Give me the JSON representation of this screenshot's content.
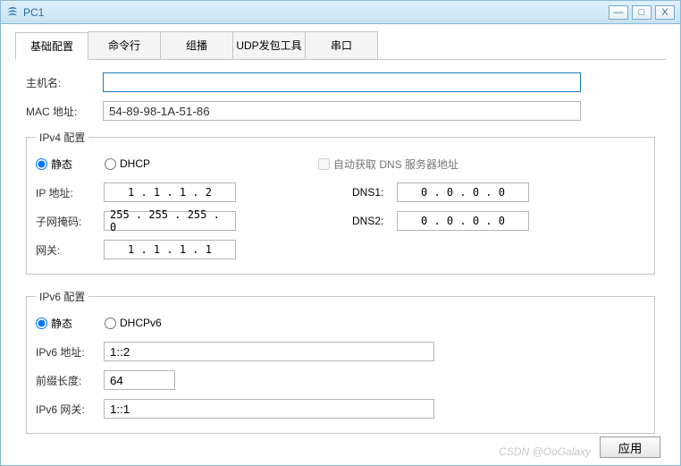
{
  "window": {
    "title": "PC1"
  },
  "tabs": [
    {
      "label": "基础配置",
      "active": true
    },
    {
      "label": "命令行",
      "active": false
    },
    {
      "label": "组播",
      "active": false
    },
    {
      "label": "UDP发包工具",
      "active": false
    },
    {
      "label": "串口",
      "active": false
    }
  ],
  "basic": {
    "hostLabel": "主机名:",
    "hostValue": "",
    "macLabel": "MAC 地址:",
    "macValue": "54-89-98-1A-51-86"
  },
  "ipv4": {
    "legend": "IPv4 配置",
    "staticLabel": "静态",
    "dhcpLabel": "DHCP",
    "autoDnsLabel": "自动获取 DNS 服务器地址",
    "ipLabel": "IP 地址:",
    "ipValue": "1   .   1   .   1   .   2",
    "maskLabel": "子网掩码:",
    "maskValue": "255  . 255  . 255  .   0",
    "gwLabel": "网关:",
    "gwValue": "1   .   1   .   1   .   1",
    "dns1Label": "DNS1:",
    "dns1Value": "0   .   0   .   0   .   0",
    "dns2Label": "DNS2:",
    "dns2Value": "0   .   0   .   0   .   0"
  },
  "ipv6": {
    "legend": "IPv6 配置",
    "staticLabel": "静态",
    "dhcpLabel": "DHCPv6",
    "addrLabel": "IPv6 地址:",
    "addrValue": "1::2",
    "prefixLabel": "前缀长度:",
    "prefixValue": "64",
    "gwLabel": "IPv6 网关:",
    "gwValue": "1::1"
  },
  "footer": {
    "applyLabel": "应用"
  },
  "watermark": "CSDN @OoGalaxy"
}
